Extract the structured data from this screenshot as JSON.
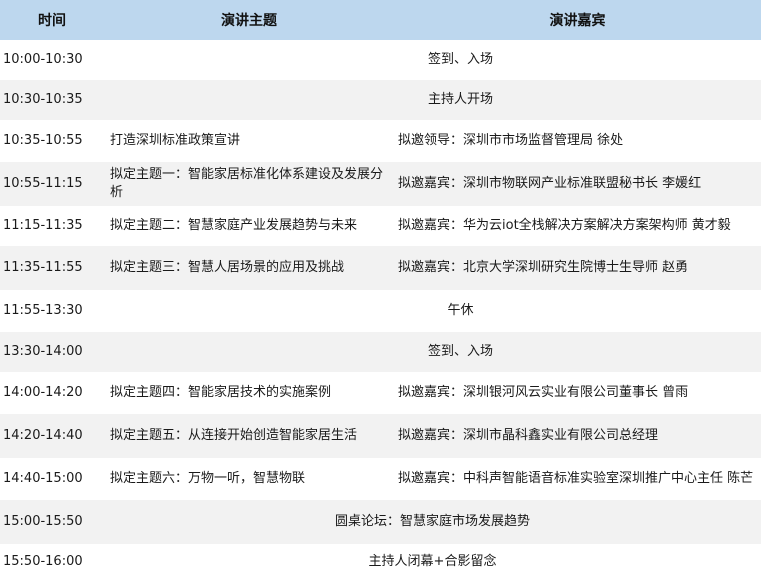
{
  "header": {
    "time": "时间",
    "topic": "演讲主题",
    "speaker": "演讲嘉宾"
  },
  "rows": [
    {
      "time": "10:00-10:30",
      "merged": "签到、入场"
    },
    {
      "time": "10:30-10:35",
      "merged": "主持人开场"
    },
    {
      "time": "10:35-10:55",
      "topic": "打造深圳标准政策宣讲",
      "speaker": "拟邀领导：深圳市市场监督管理局  徐处"
    },
    {
      "time": "10:55-11:15",
      "topic": "拟定主题一：智能家居标准化体系建设及发展分析",
      "speaker": "拟邀嘉宾：深圳市物联网产业标准联盟秘书长  李媛红"
    },
    {
      "time": "11:15-11:35",
      "topic": "拟定主题二：智慧家庭产业发展趋势与未来",
      "speaker": "拟邀嘉宾：华为云iot全栈解决方案解决方案架构师  黄才毅"
    },
    {
      "time": "11:35-11:55",
      "topic": "拟定主题三：智慧人居场景的应用及挑战",
      "speaker": "拟邀嘉宾：北京大学深圳研究生院博士生导师 赵勇"
    },
    {
      "time": "11:55-13:30",
      "merged": "午休"
    },
    {
      "time": "13:30-14:00",
      "merged": "签到、入场"
    },
    {
      "time": "14:00-14:20",
      "topic": "拟定主题四：智能家居技术的实施案例",
      "speaker": "拟邀嘉宾：深圳银河风云实业有限公司董事长 曾雨"
    },
    {
      "time": "14:20-14:40",
      "topic": "拟定主题五：从连接开始创造智能家居生活",
      "speaker": "拟邀嘉宾：深圳市晶科鑫实业有限公司总经理"
    },
    {
      "time": "14:40-15:00",
      "topic": "拟定主题六：万物一听，智慧物联",
      "speaker": "拟邀嘉宾：中科声智能语音标准实验室深圳推广中心主任 陈芒"
    },
    {
      "time": "15:00-15:50",
      "merged": "圆桌论坛：智慧家庭市场发展趋势"
    },
    {
      "time": "15:50-16:00",
      "merged": "主持人闭幕+合影留念"
    }
  ]
}
